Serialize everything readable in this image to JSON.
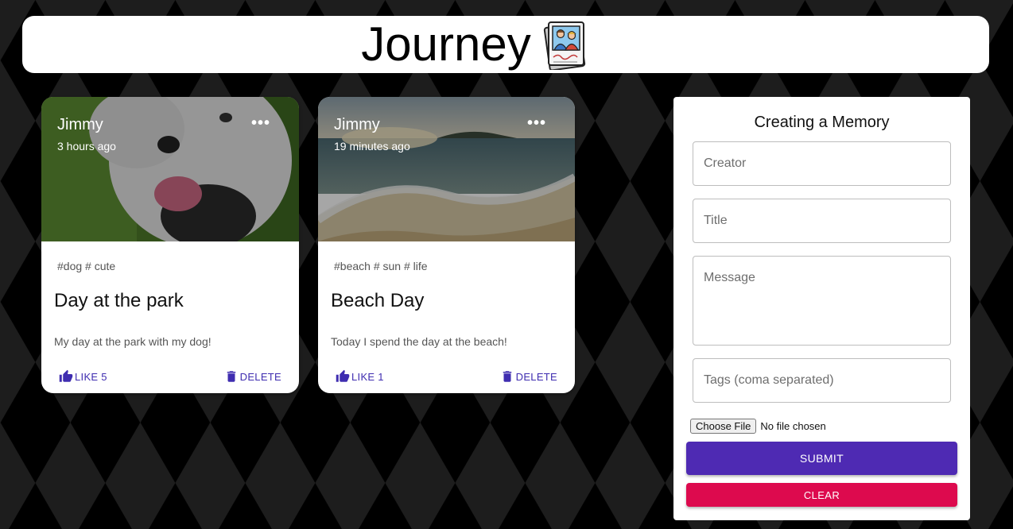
{
  "appbar": {
    "title": "Journey",
    "logo_icon": "memories-photo-icon"
  },
  "posts": [
    {
      "creator": "Jimmy",
      "time": "3 hours ago",
      "tags": "#dog # cute",
      "title": "Day at the park",
      "message": "My day at the park with my dog!",
      "like_label": "LIKE 5",
      "delete_label": "DELETE",
      "image": "dog-photo"
    },
    {
      "creator": "Jimmy",
      "time": "19 minutes ago",
      "tags": "#beach # sun # life",
      "title": "Beach Day",
      "message": "Today I spend the day at the beach!",
      "like_label": "LIKE 1",
      "delete_label": "DELETE",
      "image": "beach-photo"
    }
  ],
  "form": {
    "title": "Creating a Memory",
    "creator_placeholder": "Creator",
    "title_placeholder": "Title",
    "message_placeholder": "Message",
    "tags_placeholder": "Tags (coma separated)",
    "file_button": "Choose File",
    "file_status": "No file chosen",
    "submit_label": "SUBMIT",
    "clear_label": "CLEAR"
  },
  "colors": {
    "primary": "#4e2ab3",
    "secondary": "#dd0a4e",
    "link": "#3f2db0"
  }
}
